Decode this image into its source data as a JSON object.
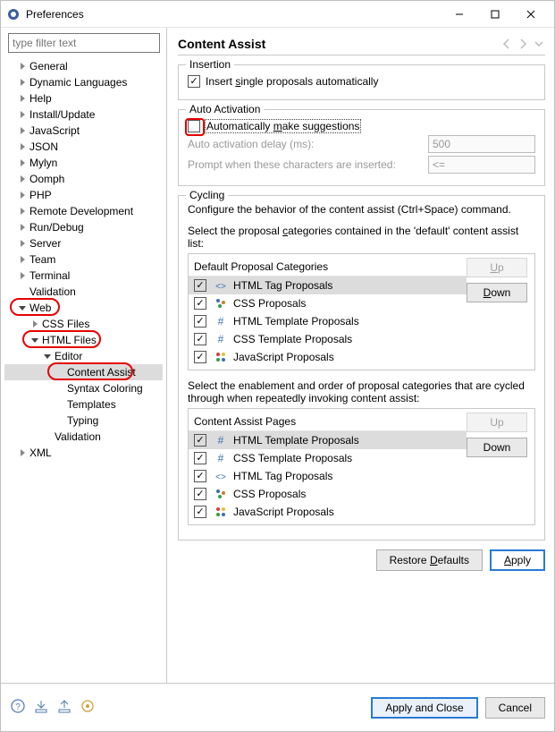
{
  "window": {
    "title": "Preferences"
  },
  "filter": {
    "placeholder": "type filter text"
  },
  "tree": [
    {
      "l": "General",
      "d": 1,
      "exp": "right"
    },
    {
      "l": "Dynamic Languages",
      "d": 1,
      "exp": "right"
    },
    {
      "l": "Help",
      "d": 1,
      "exp": "right"
    },
    {
      "l": "Install/Update",
      "d": 1,
      "exp": "right"
    },
    {
      "l": "JavaScript",
      "d": 1,
      "exp": "right"
    },
    {
      "l": "JSON",
      "d": 1,
      "exp": "right"
    },
    {
      "l": "Mylyn",
      "d": 1,
      "exp": "right"
    },
    {
      "l": "Oomph",
      "d": 1,
      "exp": "right"
    },
    {
      "l": "PHP",
      "d": 1,
      "exp": "right"
    },
    {
      "l": "Remote Development",
      "d": 1,
      "exp": "right"
    },
    {
      "l": "Run/Debug",
      "d": 1,
      "exp": "right"
    },
    {
      "l": "Server",
      "d": 1,
      "exp": "right"
    },
    {
      "l": "Team",
      "d": 1,
      "exp": "right"
    },
    {
      "l": "Terminal",
      "d": 1,
      "exp": "right"
    },
    {
      "l": "Validation",
      "d": 1
    },
    {
      "l": "Web",
      "d": 1,
      "exp": "down",
      "hl": "oval",
      "hl_w": 56
    },
    {
      "l": "CSS Files",
      "d": 2,
      "exp": "right"
    },
    {
      "l": "HTML Files",
      "d": 2,
      "exp": "down",
      "hl": "oval",
      "hl_w": 88
    },
    {
      "l": "Editor",
      "d": 3,
      "exp": "down"
    },
    {
      "l": "Content Assist",
      "d": 4,
      "sel": true,
      "hl": "oval",
      "hl_w": 96
    },
    {
      "l": "Syntax Coloring",
      "d": 4
    },
    {
      "l": "Templates",
      "d": 4
    },
    {
      "l": "Typing",
      "d": 4
    },
    {
      "l": "Validation",
      "d": 3
    },
    {
      "l": "XML",
      "d": 1,
      "exp": "right"
    }
  ],
  "page": {
    "title": "Content Assist",
    "insertion": {
      "legend": "Insertion",
      "cb1": {
        "checked": true,
        "before": "Insert ",
        "mn": "s",
        "after": "ingle proposals automatically"
      }
    },
    "auto": {
      "legend": "Auto Activation",
      "cb1": {
        "checked": false,
        "before": "Automatically ",
        "mn": "m",
        "after": "ake suggestions",
        "dotted": true,
        "hl": true
      },
      "delay_label": "Auto activation delay (ms):",
      "delay_value": "500",
      "prompt_label": "Prompt when these characters are inserted:",
      "prompt_value": "<="
    },
    "cycling": {
      "legend": "Cycling",
      "desc": "Configure the behavior of the content assist (Ctrl+Space) command.",
      "sel1_before": "Select the proposal ",
      "sel1_mn": "c",
      "sel1_after": "ategories contained in the 'default' content assist list:",
      "box1_header": "Default Proposal Categories",
      "box1_items": [
        {
          "label": "HTML Tag Proposals",
          "icon": "tag-icon",
          "checked": true,
          "sel": true
        },
        {
          "label": "CSS Proposals",
          "icon": "css-icon",
          "checked": true
        },
        {
          "label": "HTML Template Proposals",
          "icon": "hash-icon",
          "checked": true
        },
        {
          "label": "CSS Template Proposals",
          "icon": "hash-icon",
          "checked": true
        },
        {
          "label": "JavaScript Proposals",
          "icon": "js-icon",
          "checked": true
        }
      ],
      "up_label": "Up",
      "down_label": "Down",
      "sel2_text": "Select the enablement and order of proposal categories that are cycled through when repeatedly invoking content assist:",
      "box2_header": "Content Assist Pages",
      "box2_items": [
        {
          "label": "HTML Template Proposals",
          "icon": "hash-icon",
          "checked": true,
          "sel": true
        },
        {
          "label": "CSS Template Proposals",
          "icon": "hash-icon",
          "checked": true
        },
        {
          "label": "HTML Tag Proposals",
          "icon": "tag-icon",
          "checked": true
        },
        {
          "label": "CSS Proposals",
          "icon": "css-icon",
          "checked": true
        },
        {
          "label": "JavaScript Proposals",
          "icon": "js-icon",
          "checked": true
        }
      ]
    },
    "restore": "Restore Defaults",
    "apply": "Apply"
  },
  "footer": {
    "apply_close": "Apply and Close",
    "cancel": "Cancel"
  }
}
